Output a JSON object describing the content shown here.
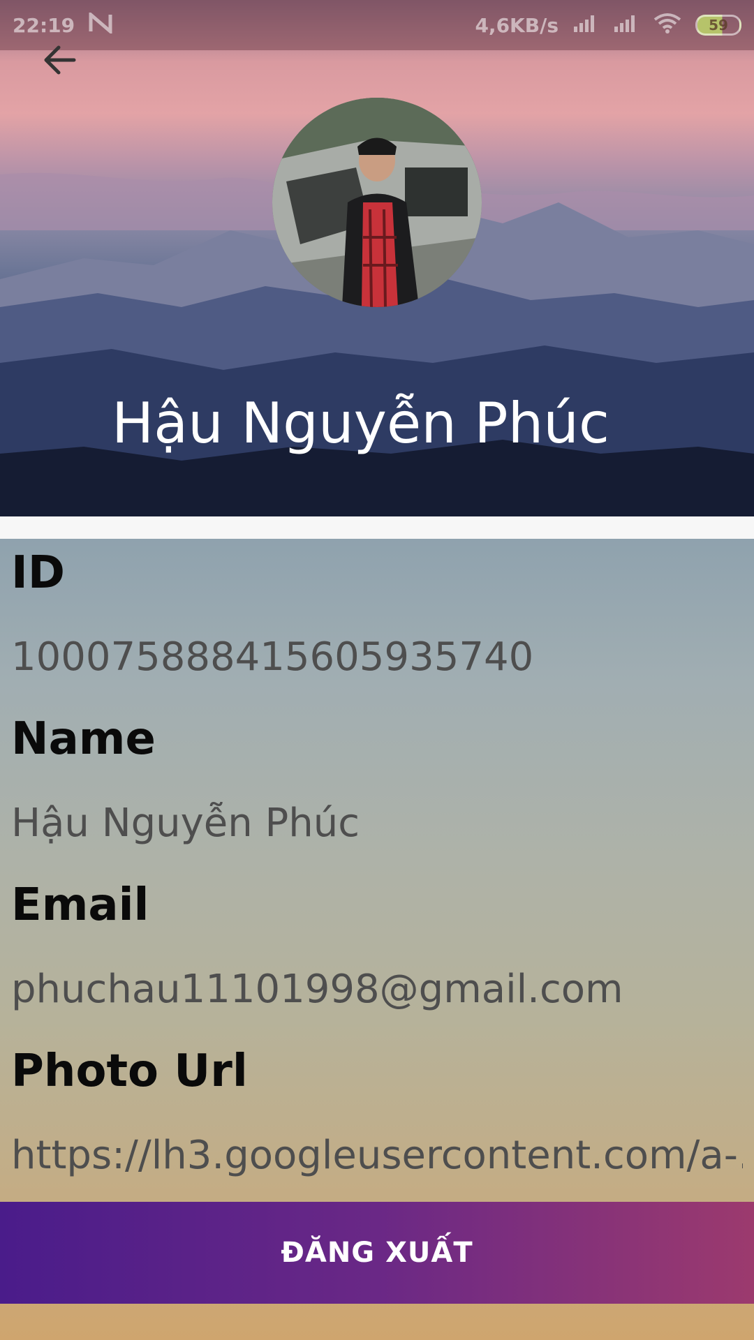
{
  "status_bar": {
    "time": "22:19",
    "network_speed": "4,6KB/s",
    "battery": "59",
    "battery_level_percent": 59
  },
  "profile": {
    "header_name": "Hậu Nguyễn Phúc"
  },
  "fields": [
    {
      "label": "ID",
      "value": "100075888415605935740"
    },
    {
      "label": "Name",
      "value": "Hậu Nguyễn Phúc"
    },
    {
      "label": "Email",
      "value": "phuchau11101998@gmail.com"
    },
    {
      "label": "Photo Url",
      "value": "https://lh3.googleusercontent.com/a-..."
    }
  ],
  "actions": {
    "logout_label": "ĐĂNG XUẤT"
  },
  "icons": {
    "back": "arrow-left-icon",
    "notification": "n-logo-icon",
    "signal": "signal-icon",
    "wifi": "wifi-icon",
    "battery": "battery-icon"
  },
  "colors": {
    "button_gradient_start": "#4a1c8a",
    "button_gradient_end": "#9c3a6e"
  }
}
